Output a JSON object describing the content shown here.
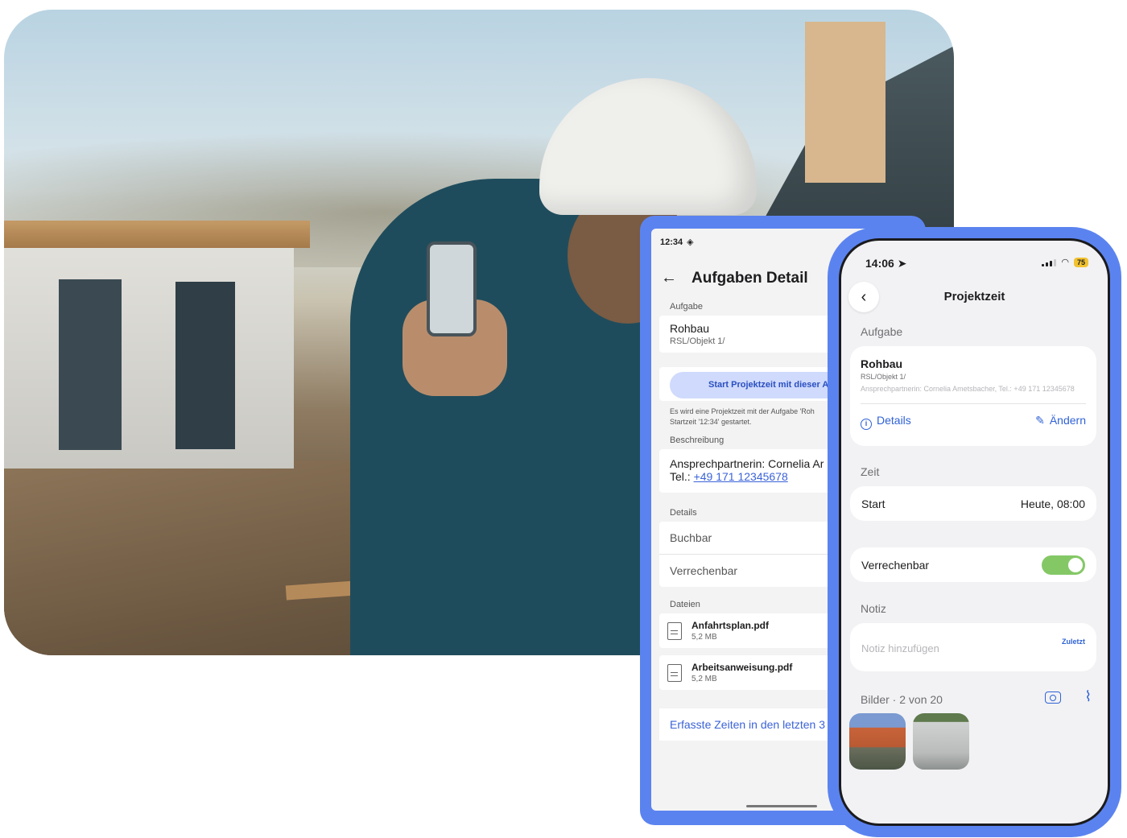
{
  "android": {
    "status_time": "12:34",
    "title": "Aufgaben Detail",
    "task_label": "Aufgabe",
    "task_name": "Rohbau",
    "task_path": "RSL/Objekt 1/",
    "start_button": "Start Projektzeit mit dieser A",
    "start_note_line1": "Es wird eine Projektzeit mit der Aufgabe 'Roh",
    "start_note_line2": "Startzeit '12:34' gestartet.",
    "description_label": "Beschreibung",
    "description_contact": "Ansprechpartnerin: Cornelia Ar",
    "description_phone_prefix": "Tel.: ",
    "description_phone": "+49 171 12345678",
    "details_label": "Details",
    "detail_rows": [
      "Buchbar",
      "Verrechenbar"
    ],
    "files_label": "Dateien",
    "files": [
      {
        "name": "Anfahrtsplan.pdf",
        "size": "5,2 MB"
      },
      {
        "name": "Arbeitsanweisung.pdf",
        "size": "5,2 MB"
      }
    ],
    "recorded_times": "Erfasste Zeiten in den letzten 3"
  },
  "iphone": {
    "status_time": "14:06",
    "battery": "75",
    "title": "Projektzeit",
    "task_label": "Aufgabe",
    "task_name": "Rohbau",
    "task_path": "RSL/Objekt 1/",
    "task_contact": "Ansprechpartnerin: Cornelia Ametsbacher, Tel.: +49 171 12345678",
    "details_link": "Details",
    "edit_link": "Ändern",
    "time_label": "Zeit",
    "start_label": "Start",
    "start_value": "Heute, 08:00",
    "billable_label": "Verrechenbar",
    "billable_on": true,
    "note_label": "Notiz",
    "note_placeholder": "Notiz hinzufügen",
    "recent_link": "Zuletzt",
    "images_label": "Bilder · 2 von 20"
  },
  "colors": {
    "device_accent": "#5b83f0",
    "link_blue": "#2f62d6",
    "toggle_green": "#84c866",
    "android_button_bg": "#cfdafc"
  }
}
